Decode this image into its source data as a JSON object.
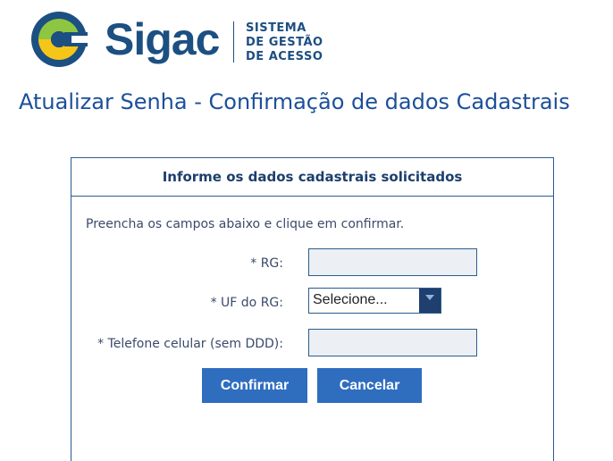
{
  "brand": {
    "name": "Sigac",
    "subtitle": [
      "SISTEMA",
      "DE GESTÃO",
      "DE ACESSO"
    ],
    "colors": {
      "blue": "#1c4f82",
      "yellow": "#f5c518"
    }
  },
  "page": {
    "title": "Atualizar Senha - Confirmação de dados Cadastrais"
  },
  "form": {
    "header": "Informe os dados cadastrais solicitados",
    "instructions": "Preencha os campos abaixo e clique em confirmar.",
    "fields": {
      "rg": {
        "label": "* RG:",
        "value": ""
      },
      "uf_rg": {
        "label": "* UF do RG:",
        "selected": "Selecione..."
      },
      "telefone": {
        "label": "* Telefone celular (sem DDD):",
        "value": ""
      }
    },
    "buttons": {
      "confirm": "Confirmar",
      "cancel": "Cancelar"
    },
    "colors": {
      "button": "#2f6dbf",
      "border": "#2b5c8f",
      "input_bg": "#eceff3"
    }
  }
}
